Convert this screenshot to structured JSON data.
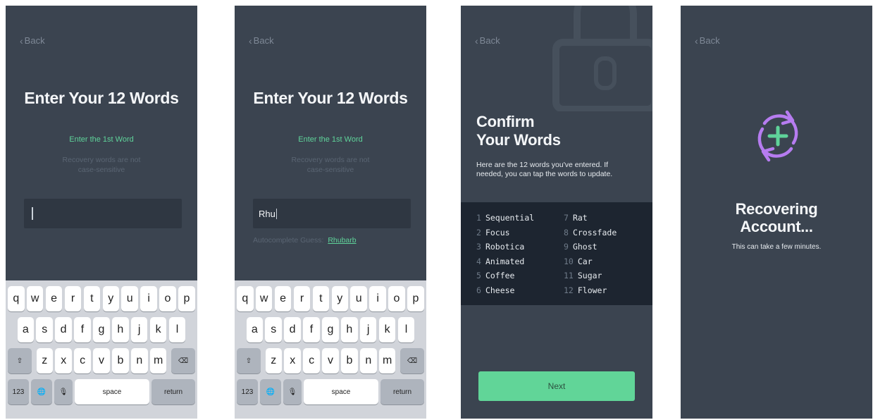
{
  "back_label": "Back",
  "enter_screen": {
    "title": "Enter Your 12 Words",
    "subtitle": "Enter the 1st Word",
    "hint_1": "Recovery words are not case-sensitive",
    "hint_2": "Recovery words are not case-sensitive"
  },
  "typing_screen": {
    "input_value": "Rhu",
    "autocomplete_prefix": "Autocomplete Guess:",
    "autocomplete_word": "Rhubarb"
  },
  "keyboard": {
    "row1": [
      "q",
      "w",
      "e",
      "r",
      "t",
      "y",
      "u",
      "i",
      "o",
      "p"
    ],
    "row2": [
      "a",
      "s",
      "d",
      "f",
      "g",
      "h",
      "j",
      "k",
      "l"
    ],
    "row3": [
      "z",
      "x",
      "c",
      "v",
      "b",
      "n",
      "m"
    ],
    "shift": "⇧",
    "delete": "⌫",
    "numbers": "123",
    "globe": "🌐",
    "mic": "🎙",
    "space": "space",
    "return": "return"
  },
  "confirm_screen": {
    "title_line1": "Confirm",
    "title_line2": "Your Words",
    "description": "Here are the 12 words you've entered. If needed, you can tap the words to update.",
    "words": [
      {
        "num": "1",
        "word": "Sequential"
      },
      {
        "num": "2",
        "word": "Focus"
      },
      {
        "num": "3",
        "word": "Robotica"
      },
      {
        "num": "4",
        "word": "Animated"
      },
      {
        "num": "5",
        "word": "Coffee"
      },
      {
        "num": "6",
        "word": "Cheese"
      },
      {
        "num": "7",
        "word": "Rat"
      },
      {
        "num": "8",
        "word": "Crossfade"
      },
      {
        "num": "9",
        "word": "Ghost"
      },
      {
        "num": "10",
        "word": "Car"
      },
      {
        "num": "11",
        "word": "Sugar"
      },
      {
        "num": "12",
        "word": "Flower"
      }
    ],
    "next_label": "Next"
  },
  "recovering_screen": {
    "title_line1": "Recovering",
    "title_line2": "Account...",
    "subtitle": "This can take a few minutes."
  },
  "colors": {
    "screen_bg": "#3b4450",
    "accent_green": "#5fd39a",
    "accent_purple": "#b67cf0",
    "panel_dark": "#1d2530",
    "button_green": "#61d598"
  }
}
